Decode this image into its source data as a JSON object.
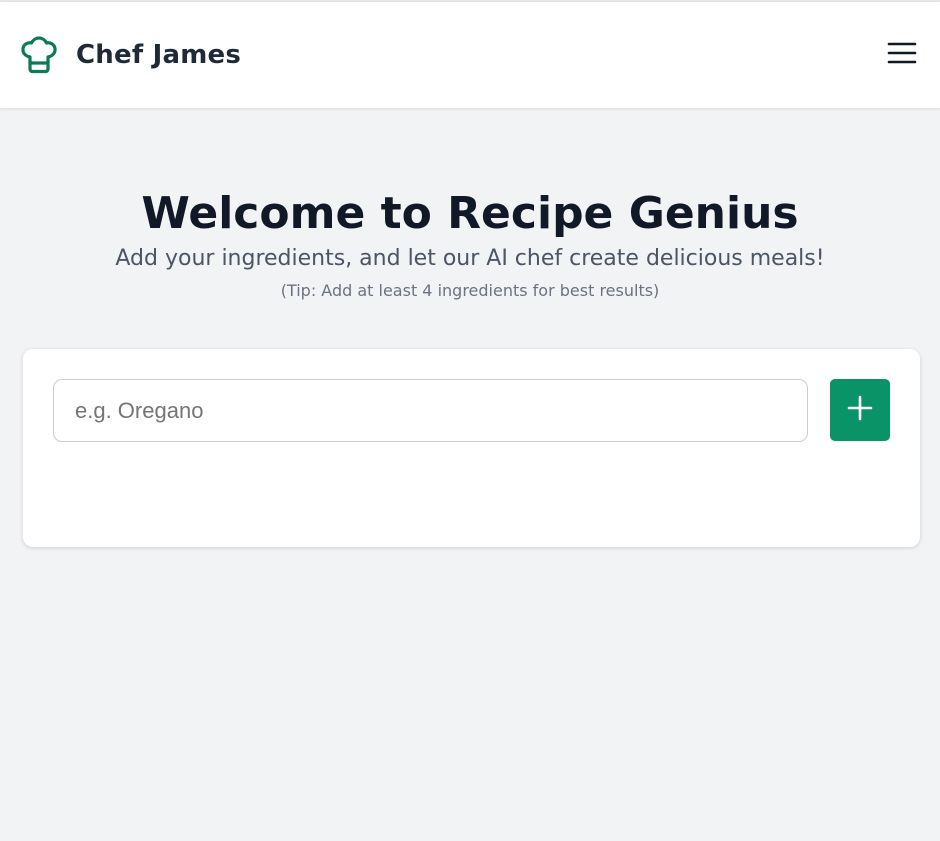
{
  "header": {
    "brand_name": "Chef James",
    "logo_icon": "chef-hat-icon",
    "menu_icon": "hamburger-menu-icon"
  },
  "hero": {
    "title": "Welcome to Recipe Genius",
    "subtitle": "Add your ingredients, and let our AI chef create delicious meals!",
    "tip": "(Tip: Add at least 4 ingredients for best results)"
  },
  "ingredient_form": {
    "input_value": "",
    "input_placeholder": "e.g. Oregano",
    "add_icon": "plus-icon"
  },
  "colors": {
    "accent": "#0a9366",
    "logo": "#0b7a56",
    "background": "#f2f3f5",
    "card": "#ffffff"
  }
}
